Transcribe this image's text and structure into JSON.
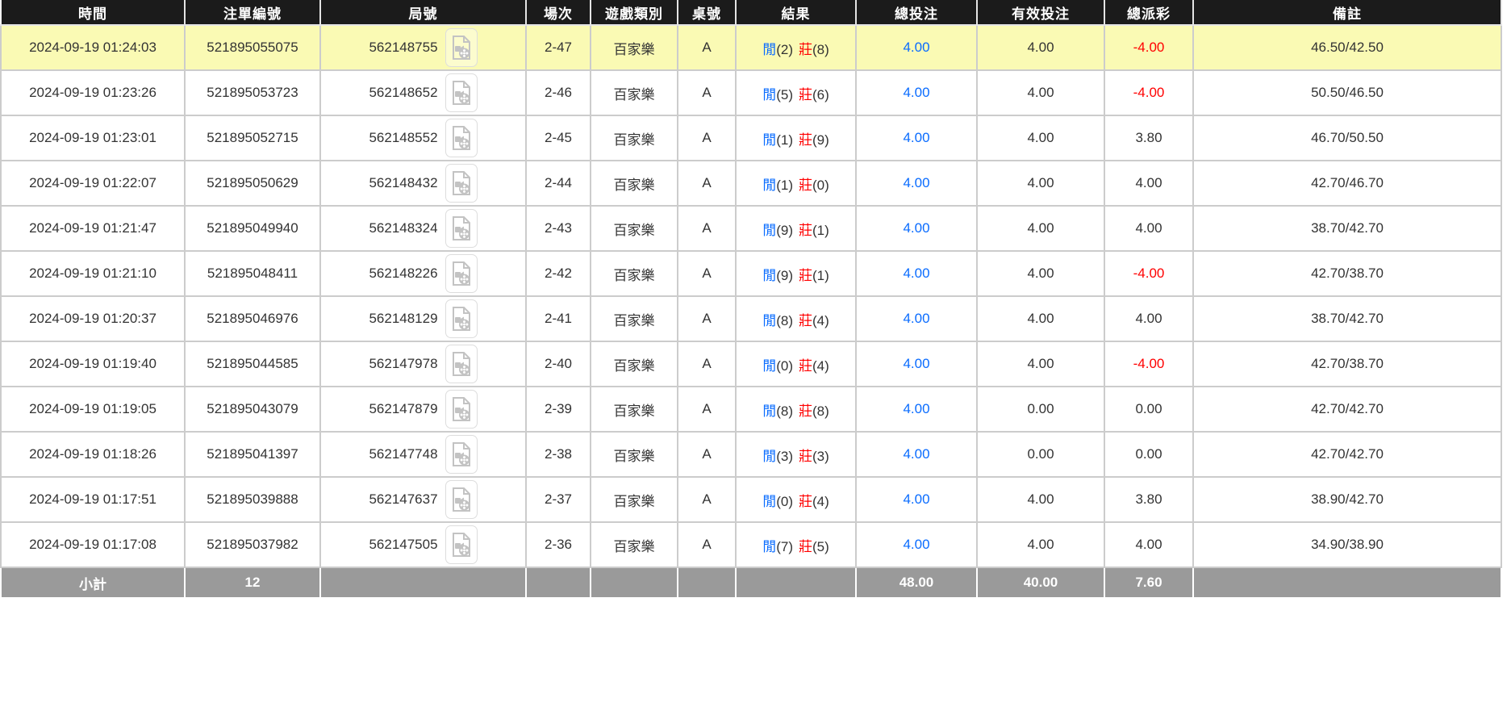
{
  "table": {
    "columns": [
      {
        "key": "time",
        "label": "時間"
      },
      {
        "key": "bet-id",
        "label": "注單編號"
      },
      {
        "key": "round-id",
        "label": "局號"
      },
      {
        "key": "session",
        "label": "場次"
      },
      {
        "key": "game-type",
        "label": "遊戲類別"
      },
      {
        "key": "table-id",
        "label": "桌號"
      },
      {
        "key": "result",
        "label": "結果"
      },
      {
        "key": "total-bet",
        "label": "總投注"
      },
      {
        "key": "valid-bet",
        "label": "有效投注"
      },
      {
        "key": "payout",
        "label": "總派彩"
      },
      {
        "key": "note",
        "label": "備註"
      }
    ],
    "result_format": {
      "player_label": "閒",
      "banker_label": "莊"
    },
    "rows": [
      {
        "time": "2024-09-19 01:24:03",
        "bet_id": "521895055075",
        "round_id": "562148755",
        "session": "2-47",
        "game_type": "百家樂",
        "table_id": "A",
        "player_score": "2",
        "banker_score": "8",
        "total_bet": "4.00",
        "valid_bet": "4.00",
        "total_payout": "-4.00",
        "note": "46.50/42.50",
        "highlighted": true
      },
      {
        "time": "2024-09-19 01:23:26",
        "bet_id": "521895053723",
        "round_id": "562148652",
        "session": "2-46",
        "game_type": "百家樂",
        "table_id": "A",
        "player_score": "5",
        "banker_score": "6",
        "total_bet": "4.00",
        "valid_bet": "4.00",
        "total_payout": "-4.00",
        "note": "50.50/46.50",
        "highlighted": false
      },
      {
        "time": "2024-09-19 01:23:01",
        "bet_id": "521895052715",
        "round_id": "562148552",
        "session": "2-45",
        "game_type": "百家樂",
        "table_id": "A",
        "player_score": "1",
        "banker_score": "9",
        "total_bet": "4.00",
        "valid_bet": "4.00",
        "total_payout": "3.80",
        "note": "46.70/50.50",
        "highlighted": false
      },
      {
        "time": "2024-09-19 01:22:07",
        "bet_id": "521895050629",
        "round_id": "562148432",
        "session": "2-44",
        "game_type": "百家樂",
        "table_id": "A",
        "player_score": "1",
        "banker_score": "0",
        "total_bet": "4.00",
        "valid_bet": "4.00",
        "total_payout": "4.00",
        "note": "42.70/46.70",
        "highlighted": false
      },
      {
        "time": "2024-09-19 01:21:47",
        "bet_id": "521895049940",
        "round_id": "562148324",
        "session": "2-43",
        "game_type": "百家樂",
        "table_id": "A",
        "player_score": "9",
        "banker_score": "1",
        "total_bet": "4.00",
        "valid_bet": "4.00",
        "total_payout": "4.00",
        "note": "38.70/42.70",
        "highlighted": false
      },
      {
        "time": "2024-09-19 01:21:10",
        "bet_id": "521895048411",
        "round_id": "562148226",
        "session": "2-42",
        "game_type": "百家樂",
        "table_id": "A",
        "player_score": "9",
        "banker_score": "1",
        "total_bet": "4.00",
        "valid_bet": "4.00",
        "total_payout": "-4.00",
        "note": "42.70/38.70",
        "highlighted": false
      },
      {
        "time": "2024-09-19 01:20:37",
        "bet_id": "521895046976",
        "round_id": "562148129",
        "session": "2-41",
        "game_type": "百家樂",
        "table_id": "A",
        "player_score": "8",
        "banker_score": "4",
        "total_bet": "4.00",
        "valid_bet": "4.00",
        "total_payout": "4.00",
        "note": "38.70/42.70",
        "highlighted": false
      },
      {
        "time": "2024-09-19 01:19:40",
        "bet_id": "521895044585",
        "round_id": "562147978",
        "session": "2-40",
        "game_type": "百家樂",
        "table_id": "A",
        "player_score": "0",
        "banker_score": "4",
        "total_bet": "4.00",
        "valid_bet": "4.00",
        "total_payout": "-4.00",
        "note": "42.70/38.70",
        "highlighted": false
      },
      {
        "time": "2024-09-19 01:19:05",
        "bet_id": "521895043079",
        "round_id": "562147879",
        "session": "2-39",
        "game_type": "百家樂",
        "table_id": "A",
        "player_score": "8",
        "banker_score": "8",
        "total_bet": "4.00",
        "valid_bet": "0.00",
        "total_payout": "0.00",
        "note": "42.70/42.70",
        "highlighted": false
      },
      {
        "time": "2024-09-19 01:18:26",
        "bet_id": "521895041397",
        "round_id": "562147748",
        "session": "2-38",
        "game_type": "百家樂",
        "table_id": "A",
        "player_score": "3",
        "banker_score": "3",
        "total_bet": "4.00",
        "valid_bet": "0.00",
        "total_payout": "0.00",
        "note": "42.70/42.70",
        "highlighted": false
      },
      {
        "time": "2024-09-19 01:17:51",
        "bet_id": "521895039888",
        "round_id": "562147637",
        "session": "2-37",
        "game_type": "百家樂",
        "table_id": "A",
        "player_score": "0",
        "banker_score": "4",
        "total_bet": "4.00",
        "valid_bet": "4.00",
        "total_payout": "3.80",
        "note": "38.90/42.70",
        "highlighted": false
      },
      {
        "time": "2024-09-19 01:17:08",
        "bet_id": "521895037982",
        "round_id": "562147505",
        "session": "2-36",
        "game_type": "百家樂",
        "table_id": "A",
        "player_score": "7",
        "banker_score": "5",
        "total_bet": "4.00",
        "valid_bet": "4.00",
        "total_payout": "4.00",
        "note": "34.90/38.90",
        "highlighted": false
      }
    ],
    "footer": {
      "label": "小計",
      "bet_count": "12",
      "total_bet": "48.00",
      "valid_bet": "40.00",
      "total_payout": "7.60"
    }
  },
  "icons": {
    "video_replay": "video-file-icon"
  },
  "colors": {
    "header_bg": "#1b1b1b",
    "highlight_row_yellow": "#fafab4",
    "footer_gray": "#9a9a9a",
    "bet_amount_blue": "#0a6cff",
    "negative_red": "#ff0000",
    "player_blue": "#0a6cff",
    "banker_red": "#ff0000"
  }
}
